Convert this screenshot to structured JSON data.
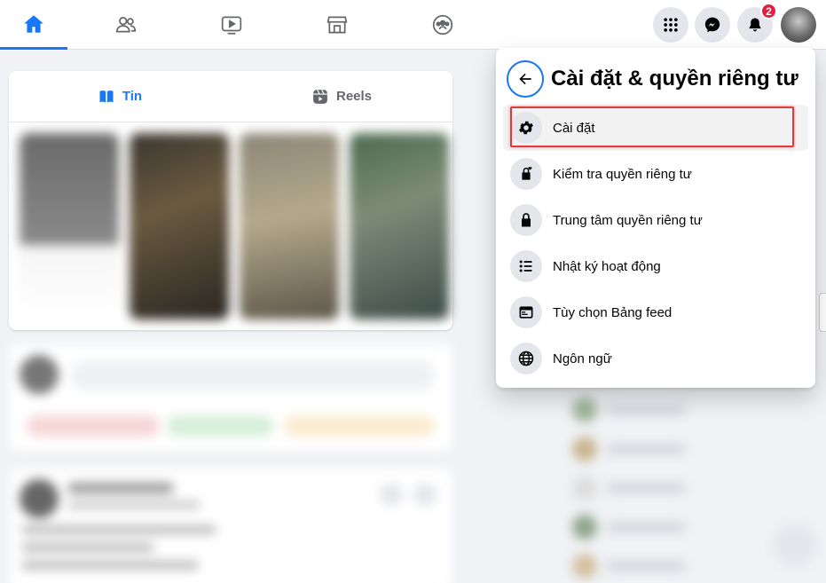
{
  "nav": {
    "tabs": [
      {
        "name": "home",
        "active": true
      },
      {
        "name": "friends",
        "active": false
      },
      {
        "name": "watch",
        "active": false
      },
      {
        "name": "marketplace",
        "active": false
      },
      {
        "name": "groups",
        "active": false
      }
    ],
    "notifications_count": "2"
  },
  "stories": {
    "tab_stories": "Tin",
    "tab_reels": "Reels"
  },
  "menu": {
    "title": "Cài đặt & quyền riêng tư",
    "items": [
      {
        "label": "Cài đặt",
        "icon": "gear-icon"
      },
      {
        "label": "Kiểm tra quyền riêng tư",
        "icon": "lock-heart-icon"
      },
      {
        "label": "Trung tâm quyền riêng tư",
        "icon": "lock-icon"
      },
      {
        "label": "Nhật ký hoạt động",
        "icon": "list-icon"
      },
      {
        "label": "Tùy chọn Bảng feed",
        "icon": "feed-icon"
      },
      {
        "label": "Ngôn ngữ",
        "icon": "globe-icon"
      }
    ]
  },
  "colors": {
    "accent": "#1877f2",
    "badge": "#e41e3f",
    "highlight_border": "#e0393e"
  }
}
